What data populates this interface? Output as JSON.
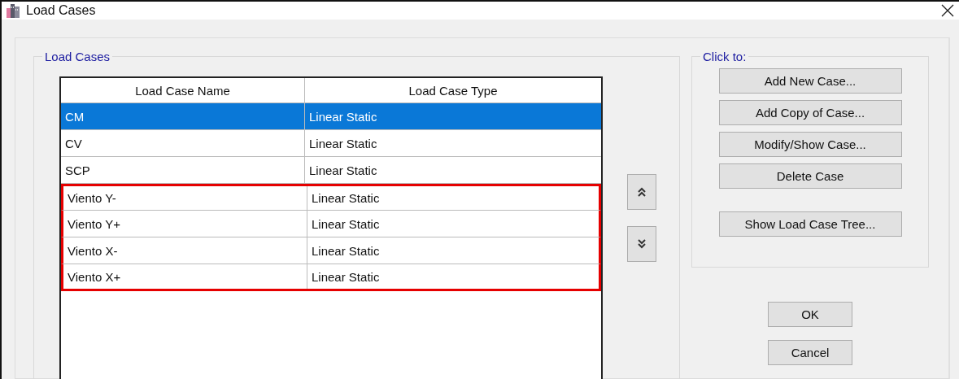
{
  "window": {
    "title": "Load Cases"
  },
  "load_cases_group": {
    "title": "Load Cases",
    "table": {
      "columns": [
        "Load Case Name",
        "Load Case Type"
      ],
      "rows": [
        {
          "name": "CM",
          "type": "Linear Static",
          "selected": true,
          "highlighted": false
        },
        {
          "name": "CV",
          "type": "Linear Static",
          "selected": false,
          "highlighted": false
        },
        {
          "name": "SCP",
          "type": "Linear Static",
          "selected": false,
          "highlighted": false
        },
        {
          "name": "Viento Y-",
          "type": "Linear Static",
          "selected": false,
          "highlighted": true
        },
        {
          "name": "Viento Y+",
          "type": "Linear Static",
          "selected": false,
          "highlighted": true
        },
        {
          "name": "Viento X-",
          "type": "Linear Static",
          "selected": false,
          "highlighted": true
        },
        {
          "name": "Viento X+",
          "type": "Linear Static",
          "selected": false,
          "highlighted": true
        }
      ]
    }
  },
  "click_to_group": {
    "title": "Click to:",
    "buttons": [
      "Add New Case...",
      "Add Copy of Case...",
      "Modify/Show Case...",
      "Delete Case"
    ],
    "tree_button": "Show Load Case Tree..."
  },
  "dialog_buttons": [
    "OK",
    "Cancel"
  ]
}
